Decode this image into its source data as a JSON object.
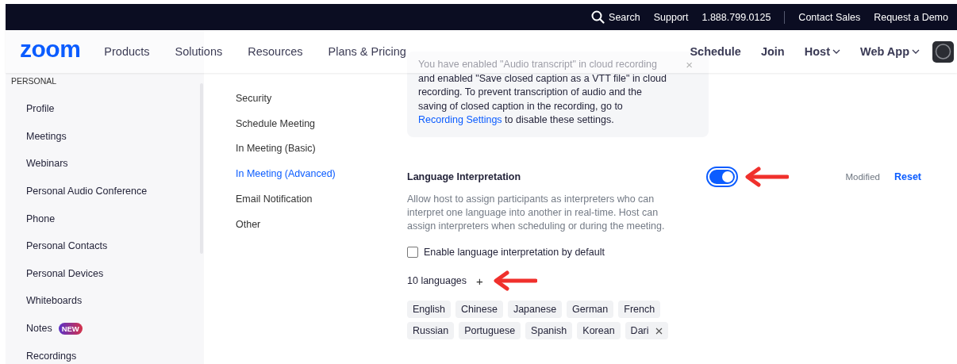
{
  "top_bar": {
    "links": [
      {
        "kind": "search",
        "label": "Search"
      },
      {
        "kind": "link",
        "label": "Support"
      },
      {
        "kind": "link",
        "label": "1.888.799.0125"
      },
      {
        "kind": "divider"
      },
      {
        "kind": "link",
        "label": "Contact Sales"
      },
      {
        "kind": "link",
        "label": "Request a Demo"
      }
    ]
  },
  "nav": {
    "logo": "zoom",
    "links": [
      "Products",
      "Solutions",
      "Resources",
      "Plans & Pricing"
    ],
    "actions": [
      {
        "label": "Schedule",
        "dropdown": false
      },
      {
        "label": "Join",
        "dropdown": false
      },
      {
        "label": "Host",
        "dropdown": true
      },
      {
        "label": "Web App",
        "dropdown": true
      }
    ]
  },
  "sidebar": {
    "section": "PERSONAL",
    "items": [
      {
        "label": "Profile"
      },
      {
        "label": "Meetings"
      },
      {
        "label": "Webinars"
      },
      {
        "label": "Personal Audio Conference"
      },
      {
        "label": "Phone"
      },
      {
        "label": "Personal Contacts"
      },
      {
        "label": "Personal Devices"
      },
      {
        "label": "Whiteboards"
      },
      {
        "label": "Notes",
        "badge": "NEW"
      },
      {
        "label": "Recordings"
      }
    ]
  },
  "settings_nav": {
    "items": [
      {
        "label": "Security",
        "selected": false
      },
      {
        "label": "Schedule Meeting",
        "selected": false
      },
      {
        "label": "In Meeting (Basic)",
        "selected": false
      },
      {
        "label": "In Meeting (Advanced)",
        "selected": true
      },
      {
        "label": "Email Notification",
        "selected": false
      },
      {
        "label": "Other",
        "selected": false
      }
    ]
  },
  "notice": {
    "text": "You have enabled \"Audio transcript\" in cloud recording and enabled \"Save closed caption as a VTT file\" in cloud recording. To prevent transcription of audio and the saving of closed caption in the recording, go to",
    "link": "Recording Settings",
    "text_after": " to disable these settings.",
    "close": "×"
  },
  "setting": {
    "title": "Language Interpretation",
    "enabled": true,
    "status": "Modified",
    "reset": "Reset",
    "description": "Allow host to assign participants as interpreters who can interpret one language into another in real-time. Host can assign interpreters when scheduling or during the meeting.",
    "option": {
      "label": "Enable language interpretation by default",
      "checked": false
    },
    "languages_count": "10 languages",
    "add": "+",
    "languages": [
      {
        "label": "English",
        "removable": false
      },
      {
        "label": "Chinese",
        "removable": false
      },
      {
        "label": "Japanese",
        "removable": false
      },
      {
        "label": "German",
        "removable": false
      },
      {
        "label": "French",
        "removable": false
      },
      {
        "label": "Russian",
        "removable": false
      },
      {
        "label": "Portuguese",
        "removable": false
      },
      {
        "label": "Spanish",
        "removable": false
      },
      {
        "label": "Korean",
        "removable": false
      },
      {
        "label": "Dari",
        "removable": true
      }
    ]
  }
}
